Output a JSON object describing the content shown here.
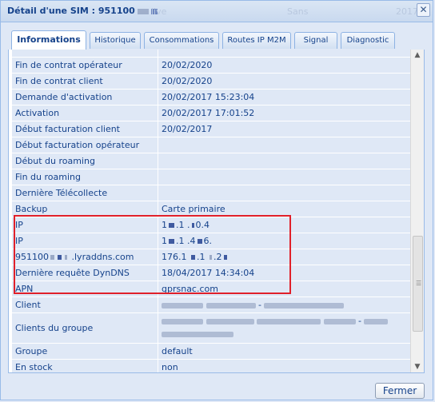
{
  "window": {
    "title": "Détail d'une SIM : 951100",
    "title_ghost_1": "live",
    "title_ghost_2": "Sans",
    "title_ghost_3": "2017-0",
    "close_glyph": "✕"
  },
  "tabs": [
    {
      "label": "Informations",
      "active": true
    },
    {
      "label": "Historique"
    },
    {
      "label": "Consommations"
    },
    {
      "label": "Routes IP M2M"
    },
    {
      "label": "Signal"
    },
    {
      "label": "Diagnostic"
    }
  ],
  "rows": [
    {
      "label": "Fin de contrat opérateur",
      "value": "20/02/2020"
    },
    {
      "label": "Fin de contrat client",
      "value": "20/02/2020"
    },
    {
      "label": "Demande d'activation",
      "value": "20/02/2017 15:23:04"
    },
    {
      "label": "Activation",
      "value": "20/02/2017 17:01:52"
    },
    {
      "label": "Début facturation client",
      "value": "20/02/2017"
    },
    {
      "label": "Début facturation opérateur",
      "value": ""
    },
    {
      "label": "Début du roaming",
      "value": ""
    },
    {
      "label": "Fin du roaming",
      "value": ""
    },
    {
      "label": "Dernière Télécollecte",
      "value": ""
    },
    {
      "label": "Backup",
      "value": "Carte primaire"
    },
    {
      "label": "IP",
      "value_a": "1",
      "value_b": ".1 .",
      "value_c": "0.4"
    },
    {
      "label": "IP",
      "value_a": "1",
      "value_b": ".1 .4",
      "value_c": "6."
    },
    {
      "label_a": "951100",
      "label_b": ".lyraddns.com",
      "value_a": "176.1",
      "value_b": ".1",
      "value_c": ".2"
    },
    {
      "label": "Dernière requête DynDNS",
      "value": "18/04/2017 14:34:04"
    },
    {
      "label": "APN",
      "value": "gprsnac.com"
    },
    {
      "label": "Client",
      "value_suffix": "-"
    },
    {
      "label": "Clients du groupe",
      "value_suffix": "-"
    },
    {
      "label": "Groupe",
      "value": "default"
    },
    {
      "label": "En stock",
      "value": "non"
    }
  ],
  "footer": {
    "close_label": "Fermer"
  },
  "scroll": {
    "up": "▲",
    "down": "▼",
    "grip": "☰"
  },
  "colors": {
    "highlight": "#e0202a",
    "row_bg": "#dfe8f6",
    "text": "#15428b"
  }
}
